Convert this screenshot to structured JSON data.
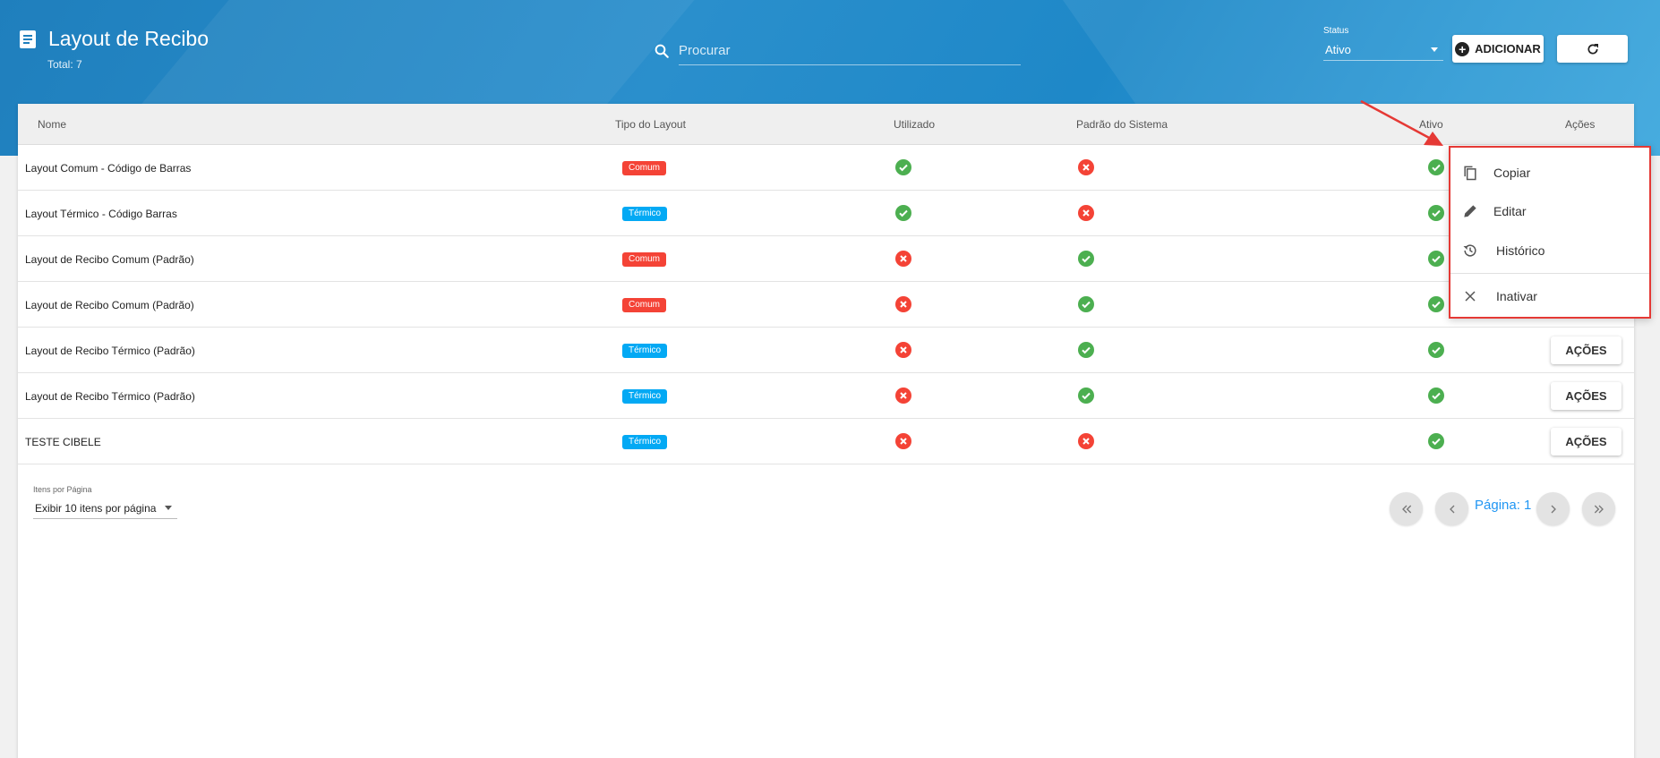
{
  "header": {
    "title": "Layout de Recibo",
    "total": "Total: 7",
    "search_placeholder": "Procurar",
    "status_label": "Status",
    "status_value": "Ativo",
    "add_label": "ADICIONAR"
  },
  "table": {
    "columns": [
      "Nome",
      "Tipo do Layout",
      "Utilizado",
      "Padrão do Sistema",
      "Ativo",
      "Ações"
    ],
    "rows": [
      {
        "name": "Layout Comum - Código de Barras",
        "type": "Comum",
        "utilizado": true,
        "padrao": false,
        "ativo": true
      },
      {
        "name": "Layout Térmico - Código Barras",
        "type": "Térmico",
        "utilizado": true,
        "padrao": false,
        "ativo": true
      },
      {
        "name": "Layout de Recibo Comum (Padrão)",
        "type": "Comum",
        "utilizado": false,
        "padrao": true,
        "ativo": true
      },
      {
        "name": "Layout de Recibo Comum (Padrão)",
        "type": "Comum",
        "utilizado": false,
        "padrao": true,
        "ativo": true
      },
      {
        "name": "Layout de Recibo Térmico (Padrão)",
        "type": "Térmico",
        "utilizado": false,
        "padrao": true,
        "ativo": true
      },
      {
        "name": "Layout de Recibo Térmico (Padrão)",
        "type": "Térmico",
        "utilizado": false,
        "padrao": true,
        "ativo": true
      },
      {
        "name": "TESTE CIBELE",
        "type": "Térmico",
        "utilizado": false,
        "padrao": false,
        "ativo": true
      }
    ],
    "acoes_label": "AÇÕES"
  },
  "footer": {
    "items_per_page_label": "Itens por Página",
    "items_per_page_value": "Exibir 10 itens por página",
    "page_label": "Página: 1"
  },
  "menu": {
    "items": [
      {
        "label": "Copiar",
        "icon": "copy-icon"
      },
      {
        "label": "Editar",
        "icon": "pencil-icon"
      },
      {
        "label": "Histórico",
        "icon": "history-icon"
      },
      {
        "label": "Inativar",
        "icon": "close-icon"
      }
    ]
  },
  "colors": {
    "header_blue": "#1f7fbd",
    "ok_green": "#4caf50",
    "no_red": "#f44336",
    "badge_comum": "#f44336",
    "badge_termico": "#03a9f4",
    "highlight_red": "#e53935",
    "page_blue": "#2196f3"
  }
}
